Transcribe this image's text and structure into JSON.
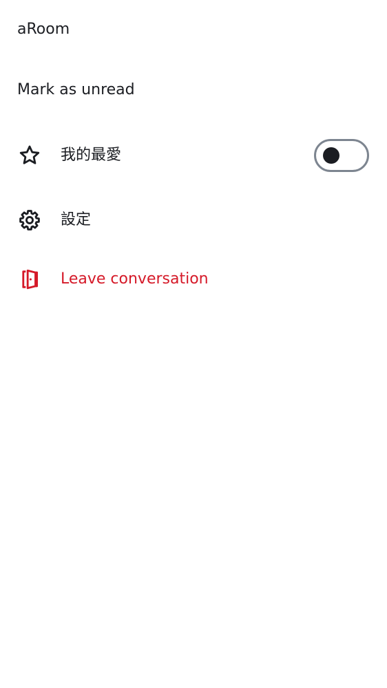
{
  "header": {
    "room_name": "aRoom"
  },
  "menu": {
    "mark_unread_label": "Mark as unread",
    "favourite": {
      "label": "我的最愛",
      "icon": "star-icon",
      "toggle_on": false
    },
    "settings": {
      "label": "設定",
      "icon": "gear-icon"
    },
    "leave": {
      "label": "Leave conversation",
      "icon": "door-leave-icon"
    }
  },
  "colors": {
    "text": "#1b1d22",
    "danger": "#d51928",
    "toggle_border": "#7d8590",
    "background": "#ffffff"
  }
}
